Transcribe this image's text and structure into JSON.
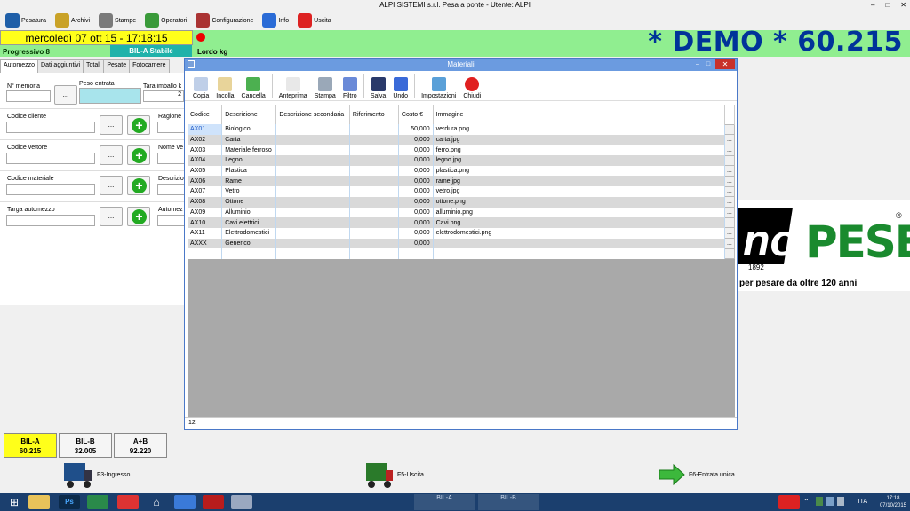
{
  "window": {
    "title": "ALPI SISTEMI s.r.l. Pesa a ponte - Utente: ALPI"
  },
  "menu": [
    {
      "label": "Pesatura",
      "icon": "truck-icon",
      "color": "#1f5fa8"
    },
    {
      "label": "Archivi",
      "icon": "archive-icon",
      "color": "#c9a227"
    },
    {
      "label": "Stampe",
      "icon": "printer-icon",
      "color": "#7a7a7a"
    },
    {
      "label": "Operatori",
      "icon": "users-icon",
      "color": "#3a9a3a"
    },
    {
      "label": "Configurazione",
      "icon": "tools-icon",
      "color": "#a33"
    },
    {
      "label": "Info",
      "icon": "info-icon",
      "color": "#2a6bd6"
    },
    {
      "label": "Uscita",
      "icon": "exit-icon",
      "color": "#d22"
    }
  ],
  "header": {
    "date": "mercoledì 07 ott 15 - 17:18:15",
    "demo_weight": "* DEMO * 60.215",
    "progressivo": "Progressivo 8",
    "bil_status": "BIL-A Stabile",
    "lordo": "Lordo kg"
  },
  "tabs": [
    "Automezzo",
    "Dati aggiuntivi",
    "Totali",
    "Pesate",
    "Fotocamere"
  ],
  "form": {
    "n_memoria": "N° memoria",
    "peso_entrata": "Peso entrata",
    "tara_imballo": "Tara imballo k",
    "tara_value": "2",
    "codice_cliente": "Codice cliente",
    "ragione": "Ragione",
    "codice_vettore": "Codice vettore",
    "nome_ve": "Nome ve",
    "codice_materiale": "Codice materiale",
    "descrizi": "Descrizio",
    "targa": "Targa automezzo",
    "automez": "Automez",
    "ellipsis": "..."
  },
  "logo": {
    "text": "PESE",
    "reg": "®",
    "year": "1892",
    "tagline": "per pesare da oltre 120 anni",
    "fragment": "no"
  },
  "modal": {
    "title": "Materiali",
    "footer_count": "12",
    "toolbar": [
      {
        "label": "Copia",
        "icon": "copy-icon"
      },
      {
        "label": "Incolla",
        "icon": "paste-icon"
      },
      {
        "label": "Cancella",
        "icon": "recycle-icon"
      },
      {
        "label": "Anteprima",
        "icon": "preview-icon"
      },
      {
        "label": "Stampa",
        "icon": "print-icon"
      },
      {
        "label": "Filtro",
        "icon": "filter-icon"
      },
      {
        "label": "Salva",
        "icon": "floppy-icon"
      },
      {
        "label": "Undo",
        "icon": "undo-icon"
      },
      {
        "label": "Impostazioni",
        "icon": "settings-icon"
      },
      {
        "label": "Chiudi",
        "icon": "close-circle-icon"
      }
    ],
    "columns": [
      "Codice",
      "Descrizione",
      "Descrizione secondaria",
      "Riferimento",
      "Costo €",
      "Immagine"
    ],
    "rows": [
      {
        "codice": "AX01",
        "descrizione": "Biologico",
        "desc2": "",
        "rif": "",
        "costo": "50,000",
        "img": "verdura.png"
      },
      {
        "codice": "AX02",
        "descrizione": "Carta",
        "desc2": "",
        "rif": "",
        "costo": "0,000",
        "img": "carta.jpg"
      },
      {
        "codice": "AX03",
        "descrizione": "Materiale ferroso",
        "desc2": "",
        "rif": "",
        "costo": "0,000",
        "img": "ferro.png"
      },
      {
        "codice": "AX04",
        "descrizione": "Legno",
        "desc2": "",
        "rif": "",
        "costo": "0,000",
        "img": "legno.jpg"
      },
      {
        "codice": "AX05",
        "descrizione": "Plastica",
        "desc2": "",
        "rif": "",
        "costo": "0,000",
        "img": "plastica.png"
      },
      {
        "codice": "AX06",
        "descrizione": "Rame",
        "desc2": "",
        "rif": "",
        "costo": "0,000",
        "img": "rame.jpg"
      },
      {
        "codice": "AX07",
        "descrizione": "Vetro",
        "desc2": "",
        "rif": "",
        "costo": "0,000",
        "img": "vetro.jpg"
      },
      {
        "codice": "AX08",
        "descrizione": "Ottone",
        "desc2": "",
        "rif": "",
        "costo": "0,000",
        "img": "ottone.png"
      },
      {
        "codice": "AX09",
        "descrizione": "Alluminio",
        "desc2": "",
        "rif": "",
        "costo": "0,000",
        "img": "alluminio.png"
      },
      {
        "codice": "AX10",
        "descrizione": "Cavi elettrici",
        "desc2": "",
        "rif": "",
        "costo": "0,000",
        "img": "Cavi.png"
      },
      {
        "codice": "AX11",
        "descrizione": "Elettrodomestici",
        "desc2": "",
        "rif": "",
        "costo": "0,000",
        "img": "elettrodomestici.png"
      },
      {
        "codice": "AXXX",
        "descrizione": "Generico",
        "desc2": "",
        "rif": "",
        "costo": "0,000",
        "img": ""
      },
      {
        "codice": "",
        "descrizione": "",
        "desc2": "",
        "rif": "",
        "costo": "",
        "img": ""
      }
    ]
  },
  "tiles": [
    {
      "label": "BIL-A",
      "value": "60.215"
    },
    {
      "label": "BIL-B",
      "value": "32.005"
    },
    {
      "label": "A+B",
      "value": "92.220"
    }
  ],
  "fkeys": [
    "F3-Ingresso",
    "F5-Uscita",
    "F6-Entrata unica"
  ],
  "taskbar": {
    "lang": "ITA",
    "time": "17:18",
    "date": "07/10/2015",
    "bil_a": "BIL-A",
    "bil_b": "BIL-B"
  },
  "colors": {
    "accent_green": "#90ee90",
    "date_yellow": "#ffff1a",
    "demo_blue": "#003399",
    "brand_green": "#1a8a2e"
  }
}
